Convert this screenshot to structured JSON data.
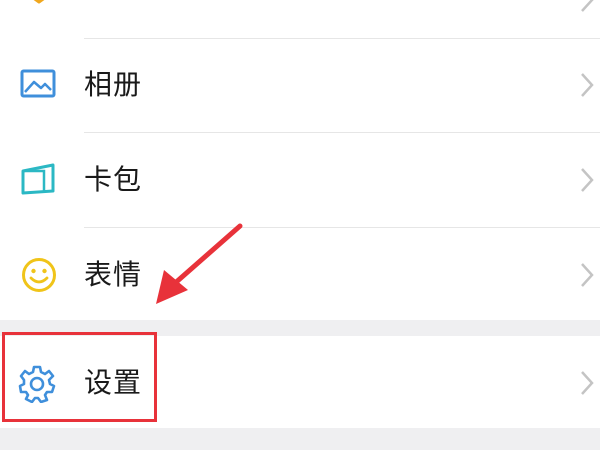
{
  "menu": {
    "items": [
      {
        "label": "相册",
        "icon": "photo-album-icon"
      },
      {
        "label": "卡包",
        "icon": "card-wallet-icon"
      },
      {
        "label": "表情",
        "icon": "emoji-smile-icon"
      },
      {
        "label": "设置",
        "icon": "settings-gear-icon"
      }
    ]
  },
  "colors": {
    "album_icon": "#3f8fdb",
    "card_icon": "#2bb8c4",
    "emoji_icon": "#f0c419",
    "settings_icon": "#3f8fdb",
    "highlight": "#e8323a",
    "section_gap": "#efeff1"
  }
}
